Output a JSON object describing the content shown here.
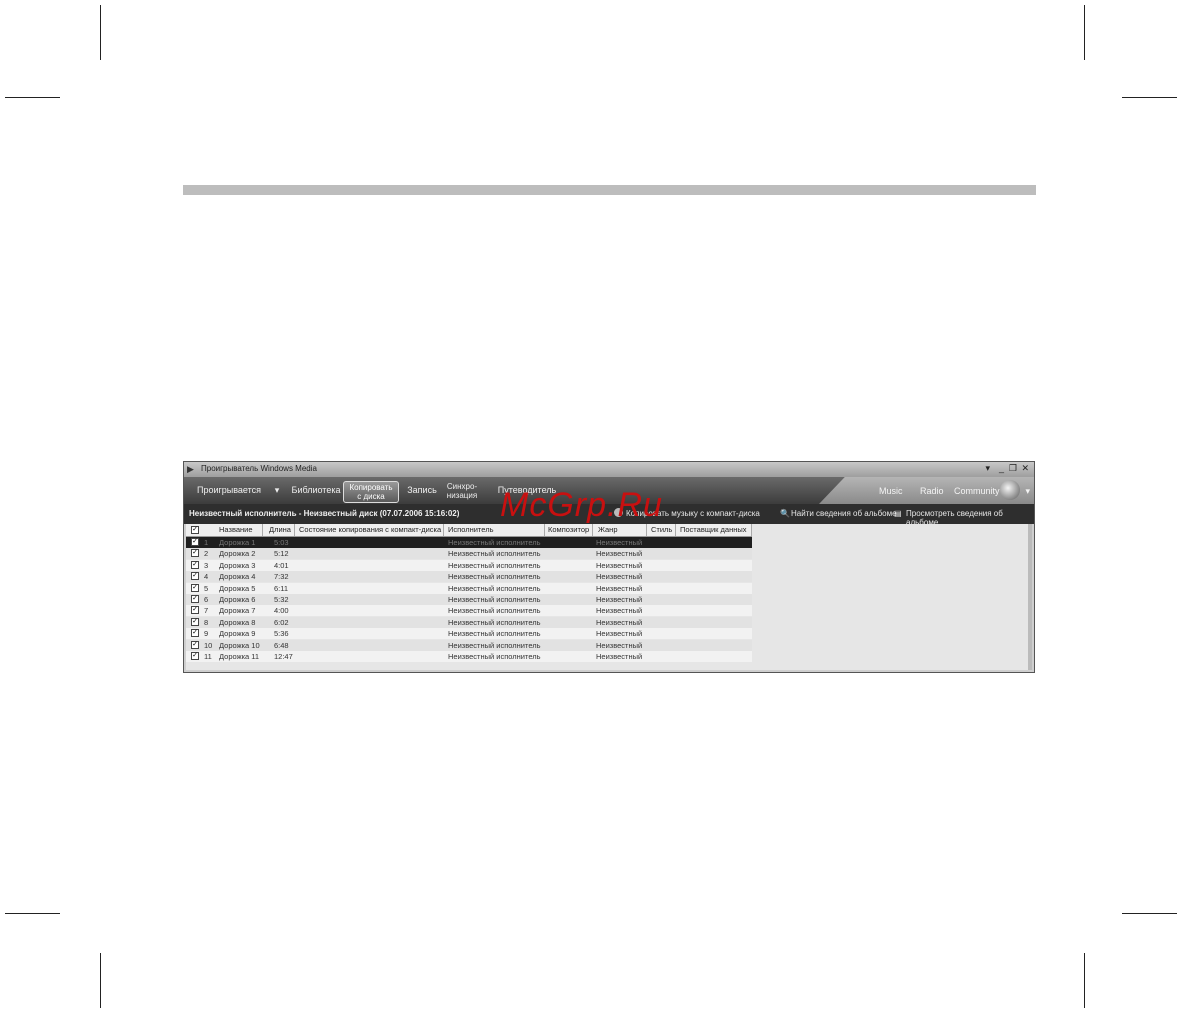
{
  "window": {
    "title": "Проигрыватель Windows Media"
  },
  "nav": {
    "tabs": [
      {
        "label": "Проигрывается"
      },
      {
        "label": "Библиотека"
      },
      {
        "label_line1": "Копировать",
        "label_line2": "с диска"
      },
      {
        "label": "Запись"
      },
      {
        "label_line1": "Синхро-",
        "label_line2": "низация"
      },
      {
        "label": "Путеводитель"
      }
    ],
    "right": [
      "Music",
      "Radio",
      "Community"
    ]
  },
  "infobar": {
    "album": "Неизвестный исполнитель - Неизвестный диск (07.07.2006 15:16:02)",
    "rip": "Копировать музыку с компакт-диска",
    "find": "Найти сведения об альбоме",
    "view": "Просмотреть сведения об альбоме"
  },
  "columns": [
    "Название",
    "Длина",
    "Состояние копирования с компакт-диска",
    "Исполнитель",
    "Композитор",
    "Жанр",
    "Стиль",
    "Поставщик данных"
  ],
  "tracks": [
    {
      "n": "1",
      "title": "Дорожка 1",
      "len": "5:03",
      "artist": "Неизвестный исполнитель",
      "genre": "Неизвестный"
    },
    {
      "n": "2",
      "title": "Дорожка 2",
      "len": "5:12",
      "artist": "Неизвестный исполнитель",
      "genre": "Неизвестный"
    },
    {
      "n": "3",
      "title": "Дорожка 3",
      "len": "4:01",
      "artist": "Неизвестный исполнитель",
      "genre": "Неизвестный"
    },
    {
      "n": "4",
      "title": "Дорожка 4",
      "len": "7:32",
      "artist": "Неизвестный исполнитель",
      "genre": "Неизвестный"
    },
    {
      "n": "5",
      "title": "Дорожка 5",
      "len": "6:11",
      "artist": "Неизвестный исполнитель",
      "genre": "Неизвестный"
    },
    {
      "n": "6",
      "title": "Дорожка 6",
      "len": "5:32",
      "artist": "Неизвестный исполнитель",
      "genre": "Неизвестный"
    },
    {
      "n": "7",
      "title": "Дорожка 7",
      "len": "4:00",
      "artist": "Неизвестный исполнитель",
      "genre": "Неизвестный"
    },
    {
      "n": "8",
      "title": "Дорожка 8",
      "len": "6:02",
      "artist": "Неизвестный исполнитель",
      "genre": "Неизвестный"
    },
    {
      "n": "9",
      "title": "Дорожка 9",
      "len": "5:36",
      "artist": "Неизвестный исполнитель",
      "genre": "Неизвестный"
    },
    {
      "n": "10",
      "title": "Дорожка 10",
      "len": "6:48",
      "artist": "Неизвестный исполнитель",
      "genre": "Неизвестный"
    },
    {
      "n": "11",
      "title": "Дорожка 11",
      "len": "12:47",
      "artist": "Неизвестный исполнитель",
      "genre": "Неизвестный"
    }
  ],
  "watermark": "McGrp.Ru"
}
